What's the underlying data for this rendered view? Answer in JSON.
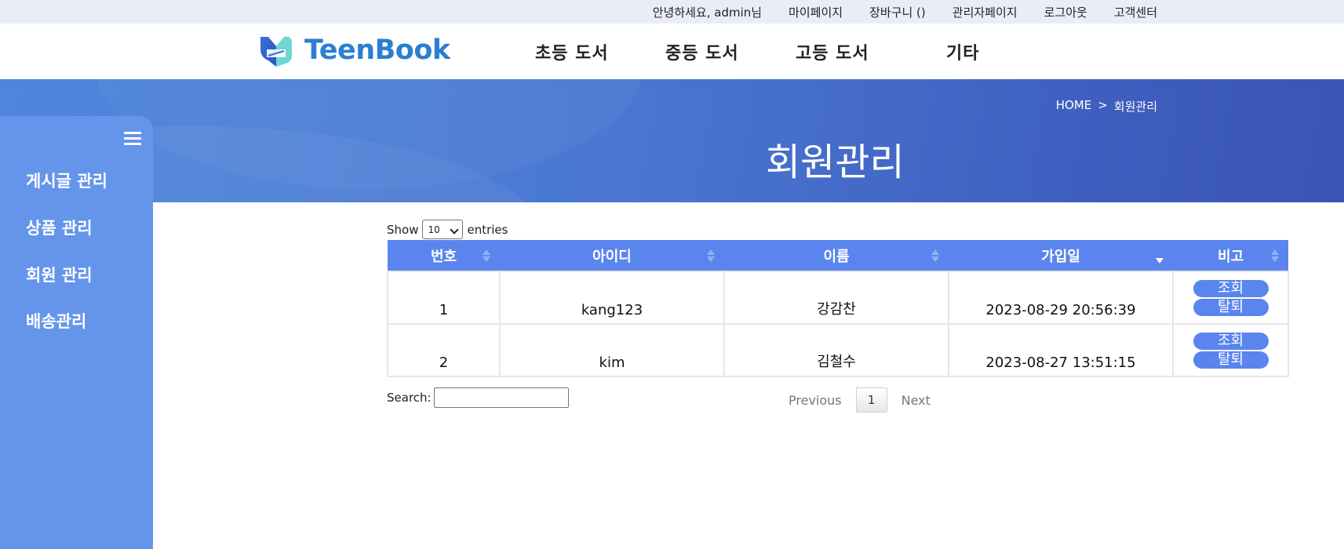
{
  "topbar": {
    "greeting": "안녕하세요, admin님",
    "mypage": "마이페이지",
    "cart": "장바구니 ()",
    "admin": "관리자페이지",
    "logout": "로그아웃",
    "support": "고객센터"
  },
  "header": {
    "logo_text": "TeenBook",
    "nav": [
      "초등 도서",
      "중등 도서",
      "고등 도서",
      "기타"
    ]
  },
  "banner": {
    "breadcrumb_home": "HOME",
    "breadcrumb_sep": ">",
    "breadcrumb_current": "회원관리",
    "title": "회원관리"
  },
  "sidebar": {
    "items": [
      {
        "label": "게시글 관리"
      },
      {
        "label": "상품 관리"
      },
      {
        "label": "회원 관리"
      },
      {
        "label": "배송관리"
      }
    ]
  },
  "table": {
    "show_label": "Show",
    "show_value": "10",
    "entries_label": "entries",
    "columns": [
      "번호",
      "아이디",
      "이름",
      "가입일",
      "비고"
    ],
    "rows": [
      {
        "no": "1",
        "id": "kang123",
        "name": "강감찬",
        "joined": "2023-08-29 20:56:39",
        "view": "조회",
        "withdraw": "탈퇴"
      },
      {
        "no": "2",
        "id": "kim",
        "name": "김철수",
        "joined": "2023-08-27 13:51:15",
        "view": "조회",
        "withdraw": "탈퇴"
      }
    ],
    "search_label": "Search:",
    "prev": "Previous",
    "page": "1",
    "next": "Next"
  },
  "colors": {
    "accent": "#5b85ee",
    "sidebar": "#6495ea",
    "logo": "#2a7fd0"
  }
}
